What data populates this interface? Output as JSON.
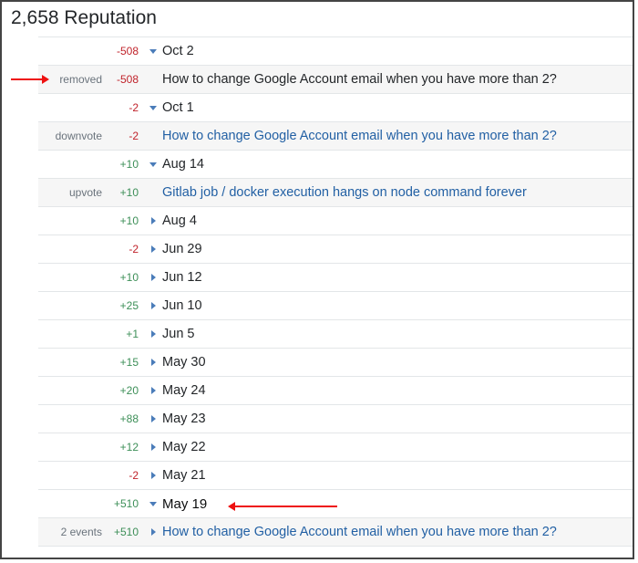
{
  "heading": "2,658 Reputation",
  "rows": [
    {
      "reason": "",
      "delta": "-508",
      "delta_class": "neg",
      "arrow": "down",
      "desc": "Oct 2",
      "desc_class": "date",
      "sub": false,
      "link": false
    },
    {
      "reason": "removed",
      "delta": "-508",
      "delta_class": "neg",
      "arrow": "",
      "desc": "How to change Google Account email when you have more than 2?",
      "desc_class": "",
      "sub": true,
      "link": false
    },
    {
      "reason": "",
      "delta": "-2",
      "delta_class": "neg",
      "arrow": "down",
      "desc": "Oct 1",
      "desc_class": "date",
      "sub": false,
      "link": false
    },
    {
      "reason": "downvote",
      "delta": "-2",
      "delta_class": "neg",
      "arrow": "",
      "desc": "How to change Google Account email when you have more than 2?",
      "desc_class": "link",
      "sub": true,
      "link": true
    },
    {
      "reason": "",
      "delta": "+10",
      "delta_class": "pos",
      "arrow": "down",
      "desc": "Aug 14",
      "desc_class": "date",
      "sub": false,
      "link": false
    },
    {
      "reason": "upvote",
      "delta": "+10",
      "delta_class": "pos",
      "arrow": "",
      "desc": "Gitlab job / docker execution hangs on node command forever",
      "desc_class": "link",
      "sub": true,
      "link": true
    },
    {
      "reason": "",
      "delta": "+10",
      "delta_class": "pos",
      "arrow": "right",
      "desc": "Aug 4",
      "desc_class": "date",
      "sub": false,
      "link": false
    },
    {
      "reason": "",
      "delta": "-2",
      "delta_class": "neg",
      "arrow": "right",
      "desc": "Jun 29",
      "desc_class": "date",
      "sub": false,
      "link": false
    },
    {
      "reason": "",
      "delta": "+10",
      "delta_class": "pos",
      "arrow": "right",
      "desc": "Jun 12",
      "desc_class": "date",
      "sub": false,
      "link": false
    },
    {
      "reason": "",
      "delta": "+25",
      "delta_class": "pos",
      "arrow": "right",
      "desc": "Jun 10",
      "desc_class": "date",
      "sub": false,
      "link": false
    },
    {
      "reason": "",
      "delta": "+1",
      "delta_class": "pos",
      "arrow": "right",
      "desc": "Jun 5",
      "desc_class": "date",
      "sub": false,
      "link": false
    },
    {
      "reason": "",
      "delta": "+15",
      "delta_class": "pos",
      "arrow": "right",
      "desc": "May 30",
      "desc_class": "date",
      "sub": false,
      "link": false
    },
    {
      "reason": "",
      "delta": "+20",
      "delta_class": "pos",
      "arrow": "right",
      "desc": "May 24",
      "desc_class": "date",
      "sub": false,
      "link": false
    },
    {
      "reason": "",
      "delta": "+88",
      "delta_class": "pos",
      "arrow": "right",
      "desc": "May 23",
      "desc_class": "date",
      "sub": false,
      "link": false
    },
    {
      "reason": "",
      "delta": "+12",
      "delta_class": "pos",
      "arrow": "right",
      "desc": "May 22",
      "desc_class": "date",
      "sub": false,
      "link": false
    },
    {
      "reason": "",
      "delta": "-2",
      "delta_class": "neg",
      "arrow": "right",
      "desc": "May 21",
      "desc_class": "date",
      "sub": false,
      "link": false
    },
    {
      "reason": "",
      "delta": "+510",
      "delta_class": "pos",
      "arrow": "down",
      "desc": "May 19",
      "desc_class": "datebold",
      "sub": false,
      "link": false
    },
    {
      "reason": "2 events",
      "delta": "+510",
      "delta_class": "pos",
      "arrow": "right",
      "desc": "How to change Google Account email when you have more than 2?",
      "desc_class": "link",
      "sub": true,
      "link": true
    }
  ]
}
